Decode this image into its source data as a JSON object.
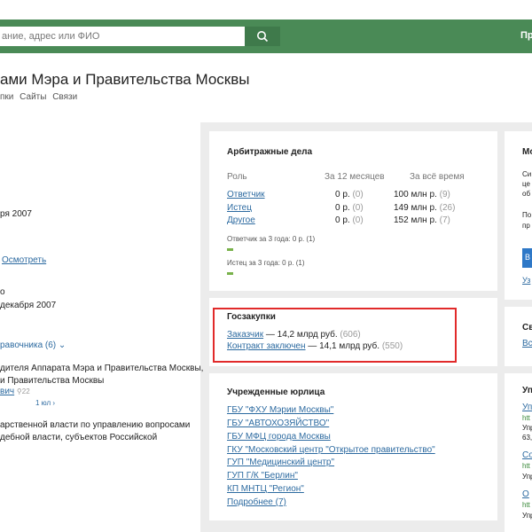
{
  "header": {
    "search_placeholder": "ание, адрес или ФИО",
    "top_link": "Пр"
  },
  "page": {
    "title": "ами Мэра и Правительства Москвы",
    "nav": [
      "пки",
      "Сайты",
      "Связи"
    ]
  },
  "left": {
    "date1": "ря 2007",
    "show_link": "Осмотреть",
    "date2": "декабря 2007",
    "directory_link": "равочника (6)",
    "text1": "дителя Аппарата Мэра и Правительства Москвы,",
    "text2": "и Правительства Москвы",
    "person_link": "вич",
    "person_count": "22",
    "person_sub": "1 юл",
    "text3": "арственной власти по управлению вопросами",
    "text4": "дебной власти, субъектов Российской"
  },
  "arbitration": {
    "title": "Арбитражные дела",
    "headers": {
      "role": "Роль",
      "year": "За 12 месяцев",
      "all": "За всё время"
    },
    "rows": [
      {
        "role": "Ответчик",
        "year_val": "0 р.",
        "year_cnt": "(0)",
        "all_val": "100 млн р.",
        "all_cnt": "(9)"
      },
      {
        "role": "Истец",
        "year_val": "0 р.",
        "year_cnt": "(0)",
        "all_val": "149 млн р.",
        "all_cnt": "(26)"
      },
      {
        "role": "Другое",
        "year_val": "0 р.",
        "year_cnt": "(0)",
        "all_val": "152 млн р.",
        "all_cnt": "(7)"
      }
    ],
    "defendant_3y": "Ответчик за 3 года: 0 р. (1)",
    "plaintiff_3y": "Истец за 3 года: 0 р. (1)"
  },
  "procurement": {
    "title": "Госзакупки",
    "customer_label": "Заказчик",
    "customer_value": " — 14,2 млрд руб.",
    "customer_count": "(606)",
    "contract_label": "Контракт заключен",
    "contract_value": " — 14,1 млрд руб.",
    "contract_count": "(550)"
  },
  "founded": {
    "title": "Учрежденные юрлица",
    "items": [
      "ГБУ \"ФХУ Мэрии Москвы\"",
      "ГБУ \"АВТОХОЗЯЙСТВО\"",
      "ГБУ МФЦ города Москвы",
      "ГКУ \"Московский центр \"Открытое правительство\"",
      "ГУП \"Медицинский центр\"",
      "ГУП Г/К \"Берлин\"",
      "КП МНТЦ \"Регион\"",
      "Подробнее (7)"
    ]
  },
  "right": {
    "c1": [
      "Мо",
      "Си",
      "це",
      "об",
      "По",
      "пр"
    ],
    "btn": "В",
    "link1": "Уз",
    "c2_title": "Св",
    "c2_link": "Вс",
    "c3_title": "Уп",
    "c3_items": [
      "Уп",
      "htt",
      "Упр",
      "63,",
      "Со",
      "htt",
      "Упр",
      "О",
      "htt",
      "Упр"
    ]
  },
  "colors": {
    "green": "#4a8a56",
    "link": "#2c6aa0",
    "highlight": "#e12a2a",
    "bar": "#79b24b"
  }
}
